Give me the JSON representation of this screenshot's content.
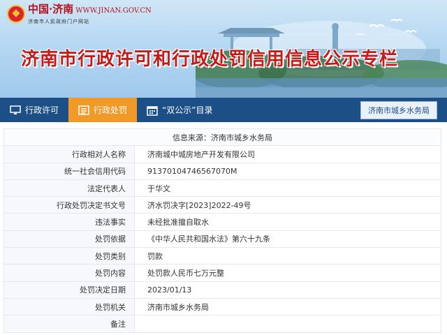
{
  "site": {
    "logo_main": "中国·济南",
    "logo_sub_domain": "WWW.JINAN.GOV.CN",
    "logo_sub": "济南市人民政府门户网站",
    "banner_title": "济南市行政许可和行政处罚信用信息公示专栏"
  },
  "nav": {
    "items": [
      {
        "label": "行政许可",
        "icon": "monitor-icon"
      },
      {
        "label": "行政处罚",
        "icon": "list-icon"
      },
      {
        "label": "“双公示”目录",
        "icon": "calendar-icon"
      }
    ],
    "department": "济南市城乡水务局"
  },
  "record": {
    "source_line": "信息来源：济南市城乡水务局",
    "rows": [
      {
        "label": "行政相对人名称",
        "value": "济南城中城房地产开发有限公司"
      },
      {
        "label": "统一社会信用代码",
        "value": "91370104746567070M"
      },
      {
        "label": "法定代表人",
        "value": "于华文"
      },
      {
        "label": "行政处罚决定书文号",
        "value": "济水罚决字[2023]2022-49号"
      },
      {
        "label": "违法事实",
        "value": "未经批准擅自取水"
      },
      {
        "label": "处罚依据",
        "value": "《中华人民共和国水法》第六十九条"
      },
      {
        "label": "处罚类别",
        "value": "罚款"
      },
      {
        "label": "处罚内容",
        "value": "处罚款人民币七万元整"
      },
      {
        "label": "处罚决定日期",
        "value": "2023/01/13"
      },
      {
        "label": "处罚机关",
        "value": "济南市城乡水务局"
      },
      {
        "label": "备注",
        "value": ""
      }
    ]
  },
  "colors": {
    "nav_bg": "#1c4f86",
    "nav_active": "#f19a27",
    "title_red": "#c31c18"
  }
}
